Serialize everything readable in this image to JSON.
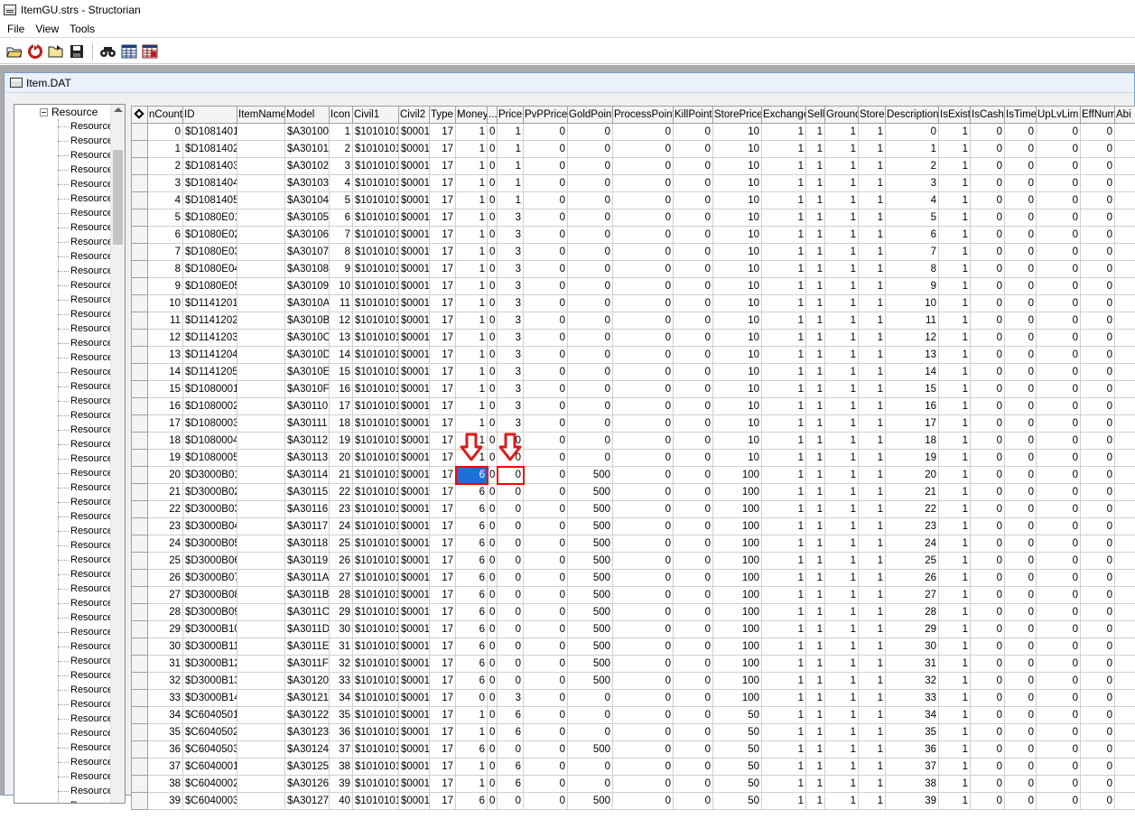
{
  "window": {
    "title": "ItemGU.strs - Structorian"
  },
  "menu": [
    {
      "label": "File",
      "name": "menu-file"
    },
    {
      "label": "View",
      "name": "menu-view"
    },
    {
      "label": "Tools",
      "name": "menu-tools"
    }
  ],
  "toolbar": [
    {
      "name": "open-folder-icon"
    },
    {
      "name": "reload-icon"
    },
    {
      "name": "open-file-icon"
    },
    {
      "name": "save-icon"
    },
    {
      "name": "sep"
    },
    {
      "name": "find-icon"
    },
    {
      "name": "grid-view-icon"
    },
    {
      "name": "table-view-icon"
    }
  ],
  "document": {
    "title": "Item.DAT"
  },
  "tree": {
    "root_label": "Resource",
    "item_label": "Resource",
    "visible_items": 48
  },
  "grid": {
    "columns": [
      "nCount",
      "ID",
      "ItemName",
      "Model",
      "Icon",
      "Civil1",
      "Civil2",
      "Type",
      "Money",
      "...",
      "Price",
      "PvPPrice",
      "GoldPoint",
      "ProcessPoint",
      "KillPoint",
      "StorePrice",
      "Exchange",
      "Sell",
      "Ground",
      "Store",
      "Description",
      "IsExist",
      "IsCash",
      "IsTime",
      "UpLvLim",
      "EffNum",
      "Abi"
    ],
    "col_widths": [
      39,
      60,
      53,
      49,
      26,
      51,
      34,
      29,
      35,
      11,
      29,
      49,
      50,
      67,
      44,
      54,
      49,
      21,
      37,
      30,
      59,
      35,
      38,
      35,
      49,
      38,
      30
    ],
    "text_cols": [
      1,
      2,
      3,
      5,
      6
    ],
    "rows": [
      [
        "0",
        "$D1081401",
        "",
        "$A30100",
        "1",
        "$1010101",
        "$0001",
        "17",
        "1",
        "0",
        "1",
        "0",
        "0",
        "0",
        "0",
        "10",
        "1",
        "1",
        "1",
        "1",
        "0",
        "1",
        "0",
        "0",
        "0",
        "0",
        ""
      ],
      [
        "1",
        "$D1081402",
        "",
        "$A30101",
        "2",
        "$1010101",
        "$0001",
        "17",
        "1",
        "0",
        "1",
        "0",
        "0",
        "0",
        "0",
        "10",
        "1",
        "1",
        "1",
        "1",
        "1",
        "1",
        "0",
        "0",
        "0",
        "0",
        ""
      ],
      [
        "2",
        "$D1081403",
        "",
        "$A30102",
        "3",
        "$1010101",
        "$0001",
        "17",
        "1",
        "0",
        "1",
        "0",
        "0",
        "0",
        "0",
        "10",
        "1",
        "1",
        "1",
        "1",
        "2",
        "1",
        "0",
        "0",
        "0",
        "0",
        ""
      ],
      [
        "3",
        "$D1081404",
        "",
        "$A30103",
        "4",
        "$1010101",
        "$0001",
        "17",
        "1",
        "0",
        "1",
        "0",
        "0",
        "0",
        "0",
        "10",
        "1",
        "1",
        "1",
        "1",
        "3",
        "1",
        "0",
        "0",
        "0",
        "0",
        ""
      ],
      [
        "4",
        "$D1081405",
        "",
        "$A30104",
        "5",
        "$1010101",
        "$0001",
        "17",
        "1",
        "0",
        "1",
        "0",
        "0",
        "0",
        "0",
        "10",
        "1",
        "1",
        "1",
        "1",
        "4",
        "1",
        "0",
        "0",
        "0",
        "0",
        ""
      ],
      [
        "5",
        "$D1080E01",
        "",
        "$A30105",
        "6",
        "$1010101",
        "$0001",
        "17",
        "1",
        "0",
        "3",
        "0",
        "0",
        "0",
        "0",
        "10",
        "1",
        "1",
        "1",
        "1",
        "5",
        "1",
        "0",
        "0",
        "0",
        "0",
        ""
      ],
      [
        "6",
        "$D1080E02",
        "",
        "$A30106",
        "7",
        "$1010101",
        "$0001",
        "17",
        "1",
        "0",
        "3",
        "0",
        "0",
        "0",
        "0",
        "10",
        "1",
        "1",
        "1",
        "1",
        "6",
        "1",
        "0",
        "0",
        "0",
        "0",
        ""
      ],
      [
        "7",
        "$D1080E03",
        "",
        "$A30107",
        "8",
        "$1010101",
        "$0001",
        "17",
        "1",
        "0",
        "3",
        "0",
        "0",
        "0",
        "0",
        "10",
        "1",
        "1",
        "1",
        "1",
        "7",
        "1",
        "0",
        "0",
        "0",
        "0",
        ""
      ],
      [
        "8",
        "$D1080E04",
        "",
        "$A30108",
        "9",
        "$1010101",
        "$0001",
        "17",
        "1",
        "0",
        "3",
        "0",
        "0",
        "0",
        "0",
        "10",
        "1",
        "1",
        "1",
        "1",
        "8",
        "1",
        "0",
        "0",
        "0",
        "0",
        ""
      ],
      [
        "9",
        "$D1080E05",
        "",
        "$A30109",
        "10",
        "$1010101",
        "$0001",
        "17",
        "1",
        "0",
        "3",
        "0",
        "0",
        "0",
        "0",
        "10",
        "1",
        "1",
        "1",
        "1",
        "9",
        "1",
        "0",
        "0",
        "0",
        "0",
        ""
      ],
      [
        "10",
        "$D1141201",
        "",
        "$A3010A",
        "11",
        "$1010101",
        "$0001",
        "17",
        "1",
        "0",
        "3",
        "0",
        "0",
        "0",
        "0",
        "10",
        "1",
        "1",
        "1",
        "1",
        "10",
        "1",
        "0",
        "0",
        "0",
        "0",
        ""
      ],
      [
        "11",
        "$D1141202",
        "",
        "$A3010B",
        "12",
        "$1010101",
        "$0001",
        "17",
        "1",
        "0",
        "3",
        "0",
        "0",
        "0",
        "0",
        "10",
        "1",
        "1",
        "1",
        "1",
        "11",
        "1",
        "0",
        "0",
        "0",
        "0",
        ""
      ],
      [
        "12",
        "$D1141203",
        "",
        "$A3010C",
        "13",
        "$1010101",
        "$0001",
        "17",
        "1",
        "0",
        "3",
        "0",
        "0",
        "0",
        "0",
        "10",
        "1",
        "1",
        "1",
        "1",
        "12",
        "1",
        "0",
        "0",
        "0",
        "0",
        ""
      ],
      [
        "13",
        "$D1141204",
        "",
        "$A3010D",
        "14",
        "$1010101",
        "$0001",
        "17",
        "1",
        "0",
        "3",
        "0",
        "0",
        "0",
        "0",
        "10",
        "1",
        "1",
        "1",
        "1",
        "13",
        "1",
        "0",
        "0",
        "0",
        "0",
        ""
      ],
      [
        "14",
        "$D1141205",
        "",
        "$A3010E",
        "15",
        "$1010101",
        "$0001",
        "17",
        "1",
        "0",
        "3",
        "0",
        "0",
        "0",
        "0",
        "10",
        "1",
        "1",
        "1",
        "1",
        "14",
        "1",
        "0",
        "0",
        "0",
        "0",
        ""
      ],
      [
        "15",
        "$D1080001",
        "",
        "$A3010F",
        "16",
        "$1010101",
        "$0001",
        "17",
        "1",
        "0",
        "3",
        "0",
        "0",
        "0",
        "0",
        "10",
        "1",
        "1",
        "1",
        "1",
        "15",
        "1",
        "0",
        "0",
        "0",
        "0",
        ""
      ],
      [
        "16",
        "$D1080002",
        "",
        "$A30110",
        "17",
        "$1010101",
        "$0001",
        "17",
        "1",
        "0",
        "3",
        "0",
        "0",
        "0",
        "0",
        "10",
        "1",
        "1",
        "1",
        "1",
        "16",
        "1",
        "0",
        "0",
        "0",
        "0",
        ""
      ],
      [
        "17",
        "$D1080003",
        "",
        "$A30111",
        "18",
        "$1010101",
        "$0001",
        "17",
        "1",
        "0",
        "3",
        "0",
        "0",
        "0",
        "0",
        "10",
        "1",
        "1",
        "1",
        "1",
        "17",
        "1",
        "0",
        "0",
        "0",
        "0",
        ""
      ],
      [
        "18",
        "$D1080004",
        "",
        "$A30112",
        "19",
        "$1010101",
        "$0001",
        "17",
        "1",
        "0",
        "0",
        "0",
        "0",
        "0",
        "0",
        "10",
        "1",
        "1",
        "1",
        "1",
        "18",
        "1",
        "0",
        "0",
        "0",
        "0",
        ""
      ],
      [
        "19",
        "$D1080005",
        "",
        "$A30113",
        "20",
        "$1010101",
        "$0001",
        "17",
        "1",
        "0",
        "0",
        "0",
        "0",
        "0",
        "0",
        "10",
        "1",
        "1",
        "1",
        "1",
        "19",
        "1",
        "0",
        "0",
        "0",
        "0",
        ""
      ],
      [
        "20",
        "$D3000B01",
        "",
        "$A30114",
        "21",
        "$1010101",
        "$0001",
        "17",
        "6",
        "0",
        "0",
        "0",
        "500",
        "0",
        "0",
        "100",
        "1",
        "1",
        "1",
        "1",
        "20",
        "1",
        "0",
        "0",
        "0",
        "0",
        ""
      ],
      [
        "21",
        "$D3000B02",
        "",
        "$A30115",
        "22",
        "$1010101",
        "$0001",
        "17",
        "6",
        "0",
        "0",
        "0",
        "500",
        "0",
        "0",
        "100",
        "1",
        "1",
        "1",
        "1",
        "21",
        "1",
        "0",
        "0",
        "0",
        "0",
        ""
      ],
      [
        "22",
        "$D3000B03",
        "",
        "$A30116",
        "23",
        "$1010101",
        "$0001",
        "17",
        "6",
        "0",
        "0",
        "0",
        "500",
        "0",
        "0",
        "100",
        "1",
        "1",
        "1",
        "1",
        "22",
        "1",
        "0",
        "0",
        "0",
        "0",
        ""
      ],
      [
        "23",
        "$D3000B04",
        "",
        "$A30117",
        "24",
        "$1010101",
        "$0001",
        "17",
        "6",
        "0",
        "0",
        "0",
        "500",
        "0",
        "0",
        "100",
        "1",
        "1",
        "1",
        "1",
        "23",
        "1",
        "0",
        "0",
        "0",
        "0",
        ""
      ],
      [
        "24",
        "$D3000B05",
        "",
        "$A30118",
        "25",
        "$1010101",
        "$0001",
        "17",
        "6",
        "0",
        "0",
        "0",
        "500",
        "0",
        "0",
        "100",
        "1",
        "1",
        "1",
        "1",
        "24",
        "1",
        "0",
        "0",
        "0",
        "0",
        ""
      ],
      [
        "25",
        "$D3000B06",
        "",
        "$A30119",
        "26",
        "$1010101",
        "$0001",
        "17",
        "6",
        "0",
        "0",
        "0",
        "500",
        "0",
        "0",
        "100",
        "1",
        "1",
        "1",
        "1",
        "25",
        "1",
        "0",
        "0",
        "0",
        "0",
        ""
      ],
      [
        "26",
        "$D3000B07",
        "",
        "$A3011A",
        "27",
        "$1010101",
        "$0001",
        "17",
        "6",
        "0",
        "0",
        "0",
        "500",
        "0",
        "0",
        "100",
        "1",
        "1",
        "1",
        "1",
        "26",
        "1",
        "0",
        "0",
        "0",
        "0",
        ""
      ],
      [
        "27",
        "$D3000B08",
        "",
        "$A3011B",
        "28",
        "$1010101",
        "$0001",
        "17",
        "6",
        "0",
        "0",
        "0",
        "500",
        "0",
        "0",
        "100",
        "1",
        "1",
        "1",
        "1",
        "27",
        "1",
        "0",
        "0",
        "0",
        "0",
        ""
      ],
      [
        "28",
        "$D3000B09",
        "",
        "$A3011C",
        "29",
        "$1010101",
        "$0001",
        "17",
        "6",
        "0",
        "0",
        "0",
        "500",
        "0",
        "0",
        "100",
        "1",
        "1",
        "1",
        "1",
        "28",
        "1",
        "0",
        "0",
        "0",
        "0",
        ""
      ],
      [
        "29",
        "$D3000B10",
        "",
        "$A3011D",
        "30",
        "$1010101",
        "$0001",
        "17",
        "6",
        "0",
        "0",
        "0",
        "500",
        "0",
        "0",
        "100",
        "1",
        "1",
        "1",
        "1",
        "29",
        "1",
        "0",
        "0",
        "0",
        "0",
        ""
      ],
      [
        "30",
        "$D3000B11",
        "",
        "$A3011E",
        "31",
        "$1010101",
        "$0001",
        "17",
        "6",
        "0",
        "0",
        "0",
        "500",
        "0",
        "0",
        "100",
        "1",
        "1",
        "1",
        "1",
        "30",
        "1",
        "0",
        "0",
        "0",
        "0",
        ""
      ],
      [
        "31",
        "$D3000B12",
        "",
        "$A3011F",
        "32",
        "$1010101",
        "$0001",
        "17",
        "6",
        "0",
        "0",
        "0",
        "500",
        "0",
        "0",
        "100",
        "1",
        "1",
        "1",
        "1",
        "31",
        "1",
        "0",
        "0",
        "0",
        "0",
        ""
      ],
      [
        "32",
        "$D3000B13",
        "",
        "$A30120",
        "33",
        "$1010101",
        "$0001",
        "17",
        "6",
        "0",
        "0",
        "0",
        "500",
        "0",
        "0",
        "100",
        "1",
        "1",
        "1",
        "1",
        "32",
        "1",
        "0",
        "0",
        "0",
        "0",
        ""
      ],
      [
        "33",
        "$D3000B14",
        "",
        "$A30121",
        "34",
        "$1010101",
        "$0001",
        "17",
        "0",
        "0",
        "3",
        "0",
        "0",
        "0",
        "0",
        "100",
        "1",
        "1",
        "1",
        "1",
        "33",
        "1",
        "0",
        "0",
        "0",
        "0",
        ""
      ],
      [
        "34",
        "$C6040501",
        "",
        "$A30122",
        "35",
        "$1010101",
        "$0001",
        "17",
        "1",
        "0",
        "6",
        "0",
        "0",
        "0",
        "0",
        "50",
        "1",
        "1",
        "1",
        "1",
        "34",
        "1",
        "0",
        "0",
        "0",
        "0",
        ""
      ],
      [
        "35",
        "$C6040502",
        "",
        "$A30123",
        "36",
        "$1010101",
        "$0001",
        "17",
        "1",
        "0",
        "6",
        "0",
        "0",
        "0",
        "0",
        "50",
        "1",
        "1",
        "1",
        "1",
        "35",
        "1",
        "0",
        "0",
        "0",
        "0",
        ""
      ],
      [
        "36",
        "$C6040503",
        "",
        "$A30124",
        "37",
        "$1010101",
        "$0001",
        "17",
        "6",
        "0",
        "0",
        "0",
        "500",
        "0",
        "0",
        "50",
        "1",
        "1",
        "1",
        "1",
        "36",
        "1",
        "0",
        "0",
        "0",
        "0",
        ""
      ],
      [
        "37",
        "$C6040001",
        "",
        "$A30125",
        "38",
        "$1010101",
        "$0001",
        "17",
        "1",
        "0",
        "6",
        "0",
        "0",
        "0",
        "0",
        "50",
        "1",
        "1",
        "1",
        "1",
        "37",
        "1",
        "0",
        "0",
        "0",
        "0",
        ""
      ],
      [
        "38",
        "$C6040002",
        "",
        "$A30126",
        "39",
        "$1010101",
        "$0001",
        "17",
        "1",
        "0",
        "6",
        "0",
        "0",
        "0",
        "0",
        "50",
        "1",
        "1",
        "1",
        "1",
        "38",
        "1",
        "0",
        "0",
        "0",
        "0",
        ""
      ],
      [
        "39",
        "$C6040003",
        "",
        "$A30127",
        "40",
        "$1010101",
        "$0001",
        "17",
        "6",
        "0",
        "0",
        "0",
        "500",
        "0",
        "0",
        "50",
        "1",
        "1",
        "1",
        "1",
        "39",
        "1",
        "0",
        "0",
        "0",
        "0",
        ""
      ]
    ],
    "selected_cell": {
      "row": 20,
      "col": 8
    },
    "highlighted_cell": {
      "row": 20,
      "col": 10
    }
  },
  "colors": {
    "selection": "#1e6fd9",
    "annotation": "#ff0000"
  }
}
